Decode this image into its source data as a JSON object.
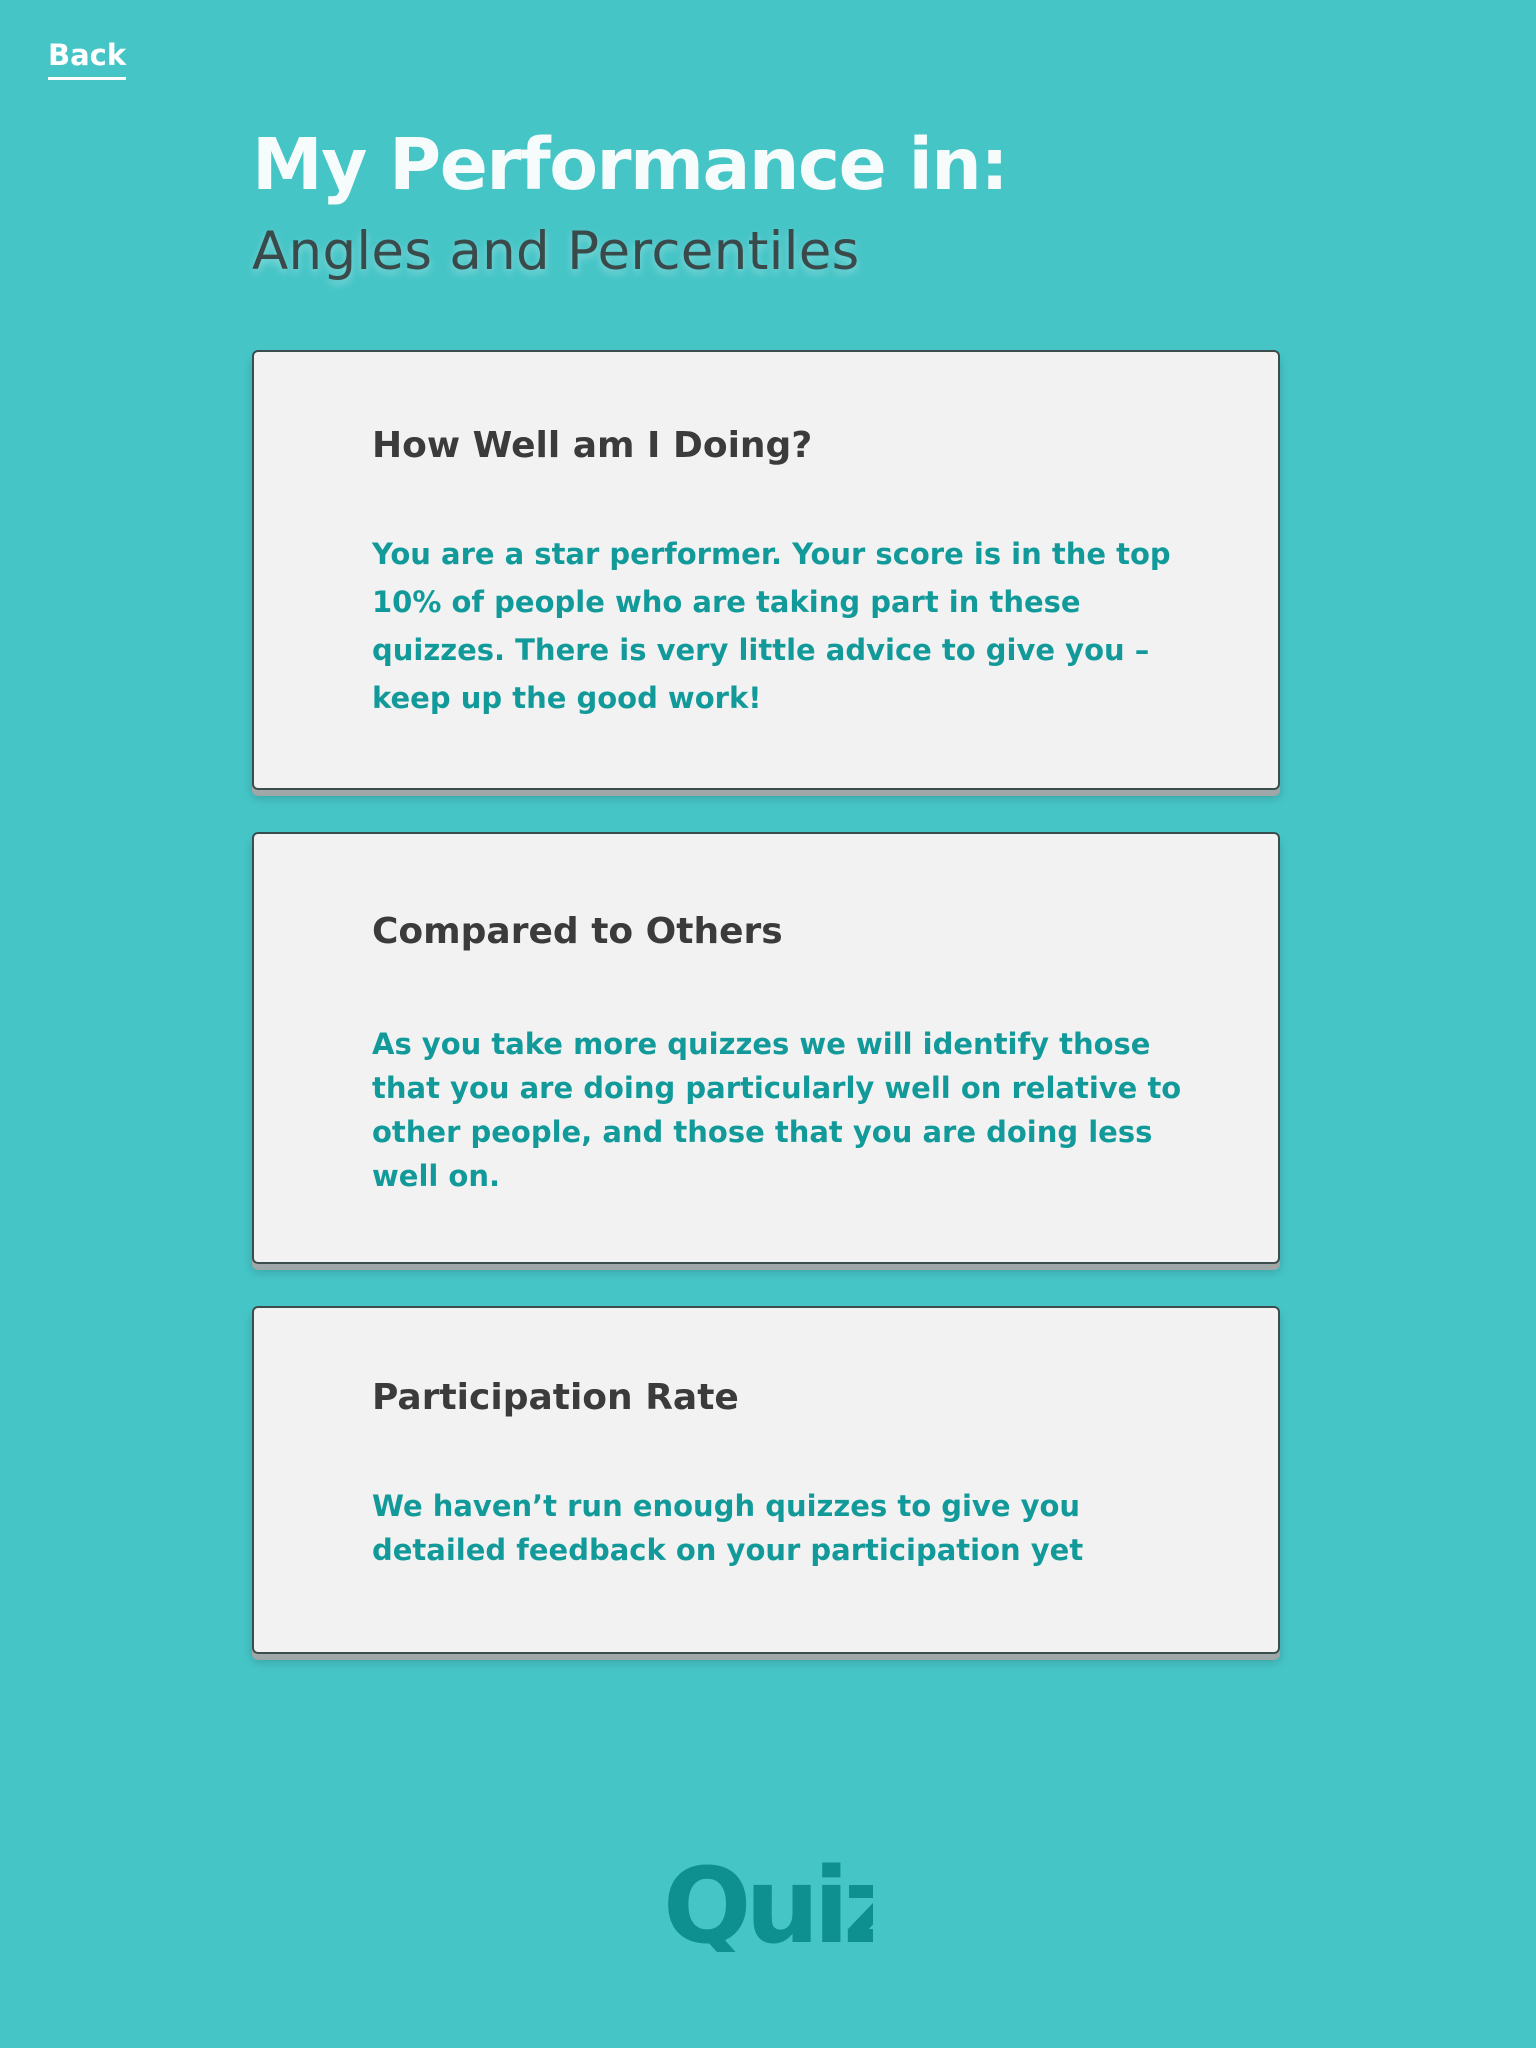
{
  "nav": {
    "back_label": "Back"
  },
  "header": {
    "title": "My Performance in:",
    "subtitle": "Angles and Percentiles"
  },
  "cards": [
    {
      "title": "How Well am I Doing?",
      "body": "You are a star performer. Your score is in the top 10% of people who are taking part in these quizzes. There is very little advice to give you – keep up the good work!"
    },
    {
      "title": "Compared to Others",
      "body": "As you take more quizzes we will identify those that you are doing particularly well on relative to other people, and those that you are doing less well on."
    },
    {
      "title": "Participation Rate",
      "body": "We haven’t run enough quizzes to give you detailed feedback on your participation yet"
    }
  ],
  "footer": {
    "logo_text": "Quiz"
  },
  "colors": {
    "background": "#46c5c7",
    "card_background": "#f2f2f2",
    "accent_teal": "#129a9a",
    "heading_dark": "#3b3b3b"
  }
}
